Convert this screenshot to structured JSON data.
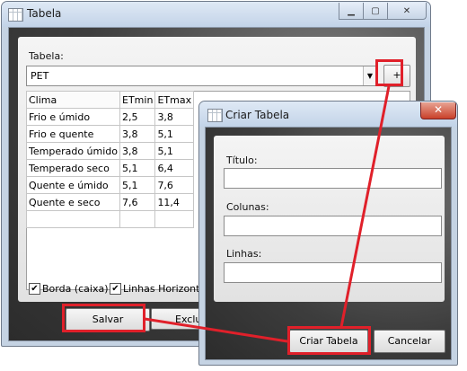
{
  "main_window": {
    "title": "Tabela",
    "table_label": "Tabela:",
    "table_select_value": "PET",
    "add_button": "+",
    "grid": {
      "columns": [
        "Clima",
        "ETmin",
        "ETmax"
      ],
      "rows": [
        [
          "Frio e úmido",
          "2,5",
          "3,8"
        ],
        [
          "Frio e quente",
          "3,8",
          "5,1"
        ],
        [
          "Temperado úmido",
          "3,8",
          "5,1"
        ],
        [
          "Temperado seco",
          "5,1",
          "6,4"
        ],
        [
          "Quente e úmido",
          "5,1",
          "7,6"
        ],
        [
          "Quente e seco",
          "7,6",
          "11,4"
        ]
      ]
    },
    "checkbox_border": "Borda (caixa)",
    "checkbox_hlines": "Linhas Horizontais",
    "save_button": "Salvar",
    "delete_button_partial": "Exclui"
  },
  "dialog": {
    "title": "Criar Tabela",
    "close_glyph": "✕",
    "title_label": "Título:",
    "columns_label": "Colunas:",
    "rows_label": "Linhas:",
    "title_value": "",
    "columns_value": "",
    "rows_value": "",
    "create_button": "Criar Tabela",
    "cancel_button": "Cancelar"
  },
  "annotation_color": "#e0202a"
}
